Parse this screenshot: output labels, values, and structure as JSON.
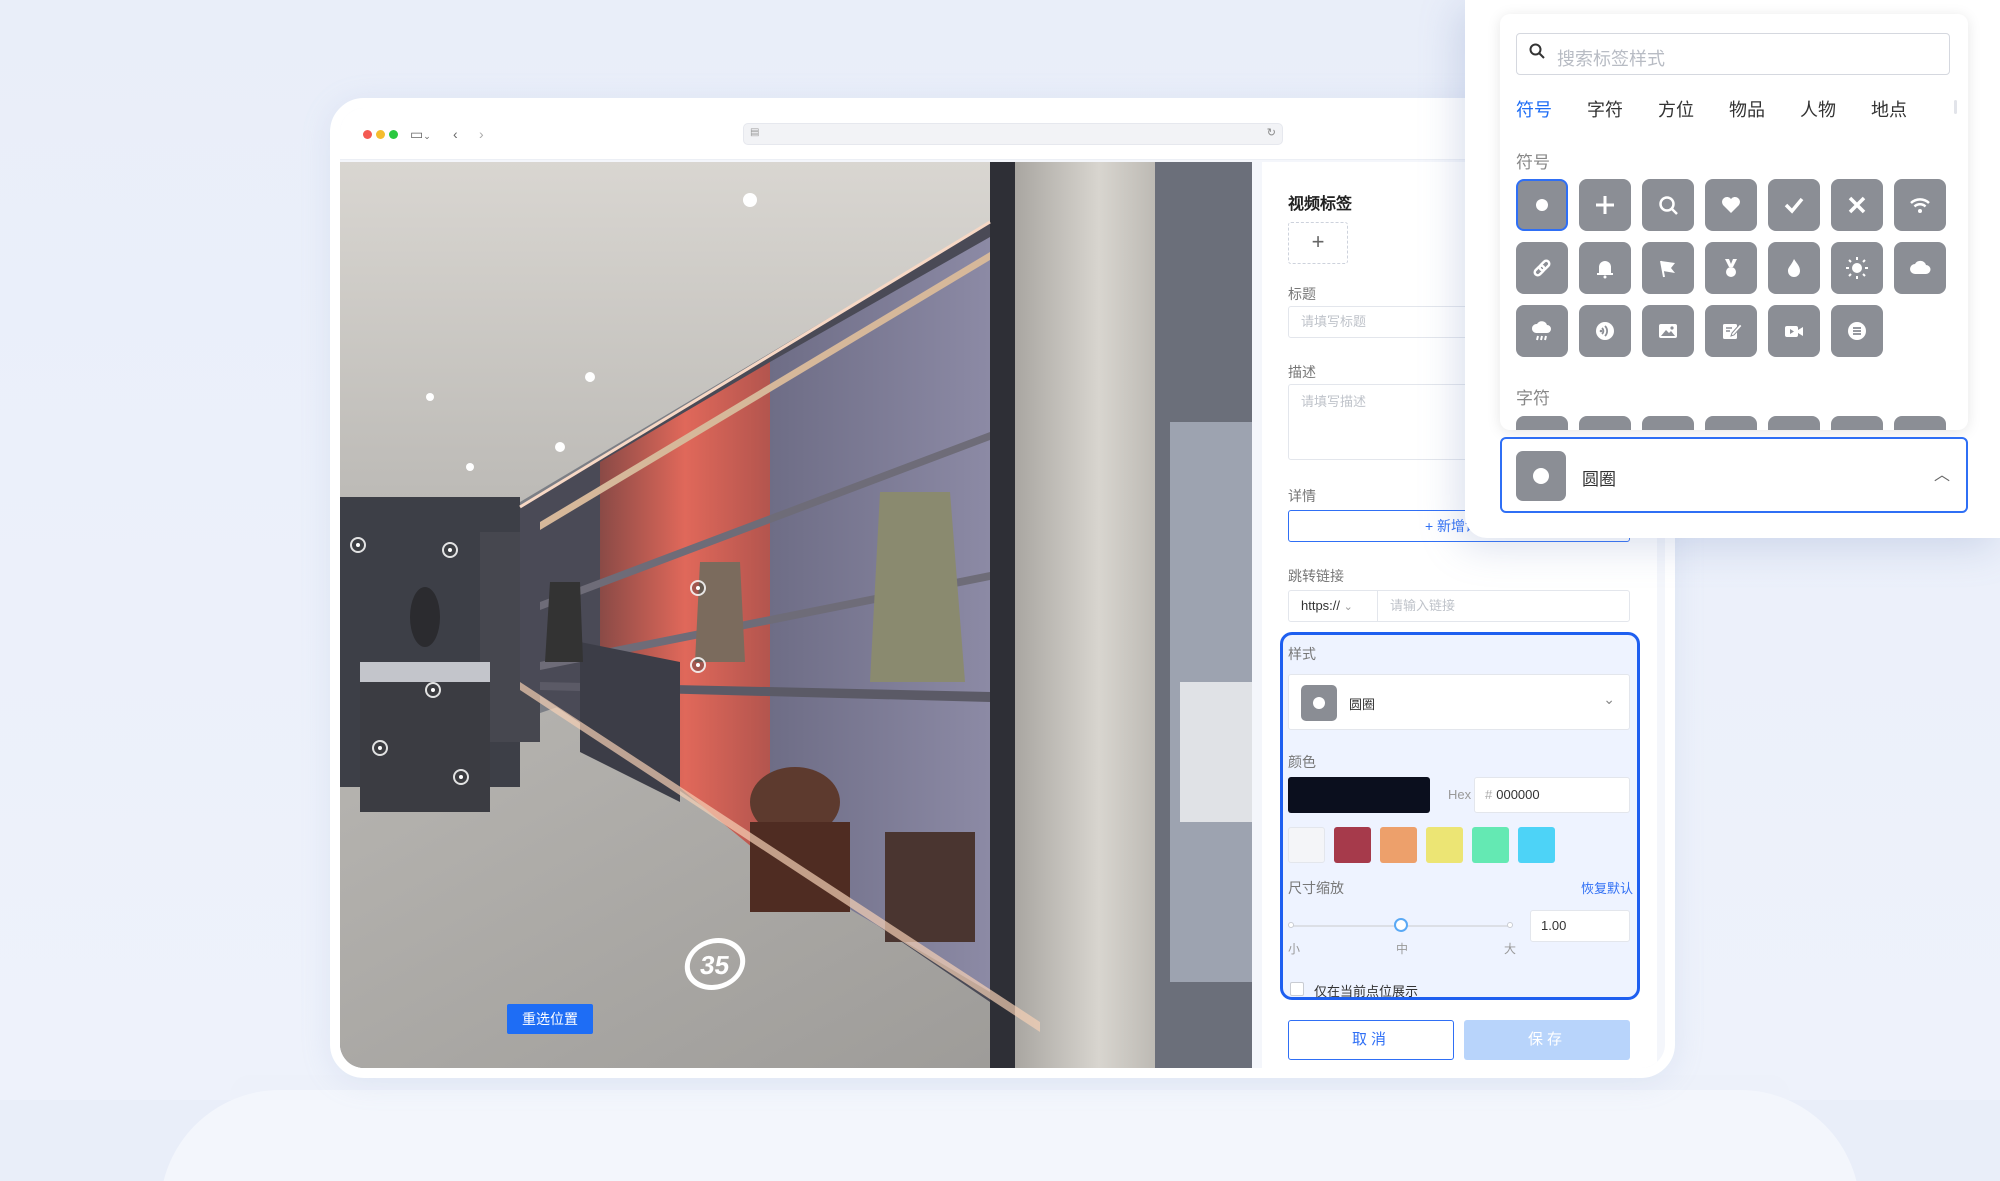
{
  "browser": {
    "url": ""
  },
  "scene": {
    "reselect_label": "重选位置",
    "hotspot_number": "35"
  },
  "form": {
    "video_tag_title": "视频标签",
    "add_symbol": "+",
    "title_label": "标题",
    "title_placeholder": "请填写标题",
    "desc_label": "描述",
    "desc_placeholder": "请填写描述",
    "details_label": "详情",
    "new_button": "+ 新增详情",
    "link_label": "跳转链接",
    "protocol_value": "https://",
    "link_placeholder": "请输入链接",
    "style_label": "样式",
    "style_value": "圆圈",
    "color_label": "颜色",
    "hex_label": "Hex",
    "hex_value": "000000",
    "main_color": "#0b0f1e",
    "swatches": [
      "#f4f5f8",
      "#a63a4b",
      "#eda06b",
      "#ece574",
      "#64e9b3",
      "#4dd3f7"
    ],
    "size_label": "尺寸缩放",
    "restore_label": "恢复默认",
    "slider_min": "小",
    "slider_mid": "中",
    "slider_max": "大",
    "scale_value": "1.00",
    "scale_fraction": 0.5,
    "only_current_label": "仅在当前点位展示",
    "cancel_label": "取消",
    "save_label": "保存"
  },
  "picker": {
    "search_placeholder": "搜索标签样式",
    "tabs": [
      "符号",
      "字符",
      "方位",
      "物品",
      "人物",
      "地点"
    ],
    "active_tab": "符号",
    "section_symbols": "符号",
    "section_chars": "字符",
    "icons": [
      "circle-icon",
      "plus-icon",
      "search-icon",
      "heart-icon",
      "check-icon",
      "close-icon",
      "wifi-icon",
      "link-icon",
      "bell-icon",
      "flag-icon",
      "medal-icon",
      "fire-icon",
      "sun-icon",
      "cloud-icon",
      "rain-icon",
      "audio-icon",
      "image-icon",
      "edit-icon",
      "video-icon",
      "text-icon"
    ],
    "selected_value": "圆圈"
  },
  "colors": {
    "accent": "#1e6df5",
    "icon_bg": "#8b8e95"
  }
}
